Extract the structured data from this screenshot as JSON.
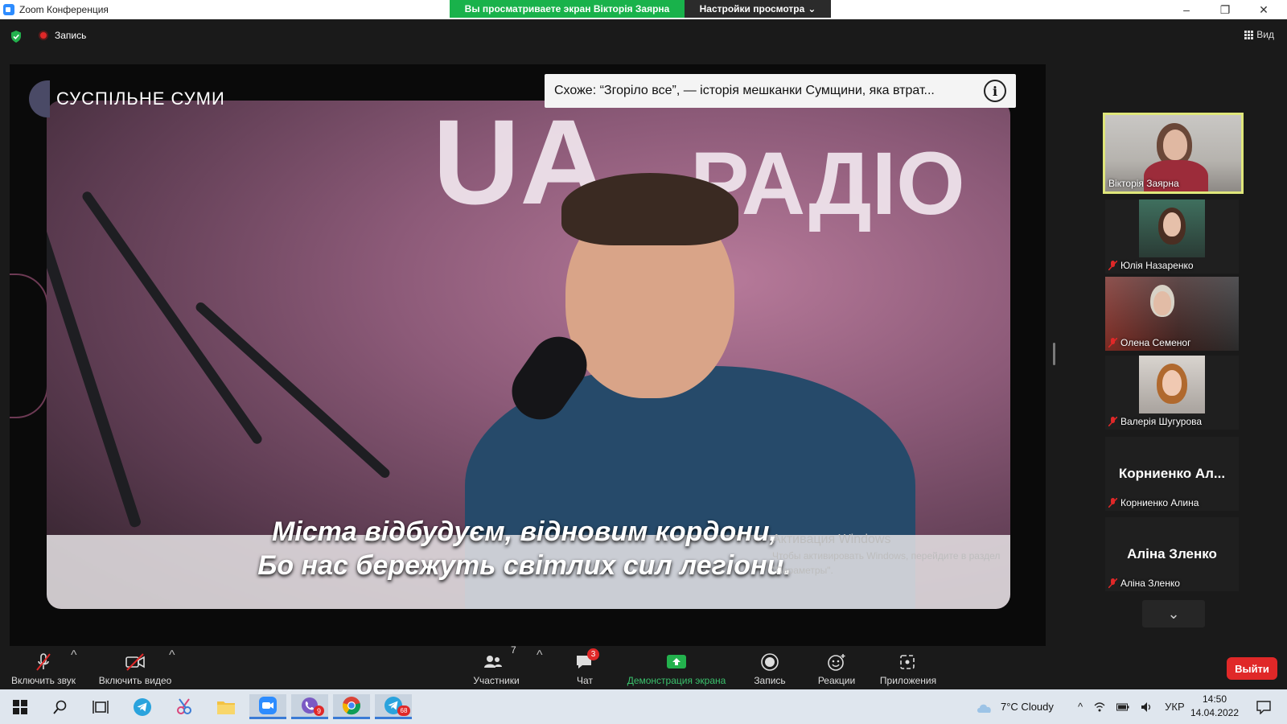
{
  "window": {
    "title": "Zoom Конференция",
    "share_banner": "Вы просматриваете экран Вікторія Заярна",
    "view_settings": "Настройки просмотра",
    "controls": [
      "–",
      "❐",
      "✕"
    ]
  },
  "topbar": {
    "record_label": "Запись",
    "view_label": "Вид"
  },
  "stage": {
    "channel_name": "СУСПІЛЬНЕ  СУМИ",
    "video_title": "Схоже: “Згоріло все”, — історія мешканки Сумщини, яка втрат...",
    "info_symbol": "i",
    "wall_text_1": "UA",
    "wall_text_2": "РАДІО",
    "subtitle_line1": "Міста відбудуєм, відновим кордони,",
    "subtitle_line2": "Бо нас бережуть світлих сил легіони.",
    "activation_title": "Активация Windows",
    "activation_text": "Чтобы активировать Windows, перейдите в раздел \"Параметры\"."
  },
  "participants": [
    {
      "name": "Вікторія Заярна",
      "active": true,
      "muted": false,
      "video": true
    },
    {
      "name": "Юлія Назаренко",
      "active": false,
      "muted": true,
      "video": true
    },
    {
      "name": "Олена Семеног",
      "active": false,
      "muted": true,
      "video": true
    },
    {
      "name": "Валерія Шугурова",
      "active": false,
      "muted": true,
      "video": true
    },
    {
      "name": "Корниенко Алина",
      "display": "Корниенко Ал...",
      "active": false,
      "muted": true,
      "video": false
    },
    {
      "name": "Аліна Зленко",
      "display": "Аліна Зленко",
      "active": false,
      "muted": true,
      "video": false
    }
  ],
  "toolbar": {
    "unmute_label": "Включить звук",
    "start_video_label": "Включить видео",
    "participants_label": "Участники",
    "participants_count": "7",
    "chat_label": "Чат",
    "chat_badge": "3",
    "share_label": "Демонстрация экрана",
    "record_label": "Запись",
    "reactions_label": "Реакции",
    "apps_label": "Приложения",
    "leave_label": "Выйти"
  },
  "taskbar": {
    "weather": "7°C  Cloudy",
    "language": "УКР",
    "time": "14:50",
    "date": "14.04.2022",
    "viber_badge": "9",
    "telegram_badge": "68"
  },
  "colors": {
    "accent_green": "#19b24b",
    "active_border": "#dfe67a",
    "leave_red": "#e02828",
    "zoom_blue": "#2d8cff"
  }
}
